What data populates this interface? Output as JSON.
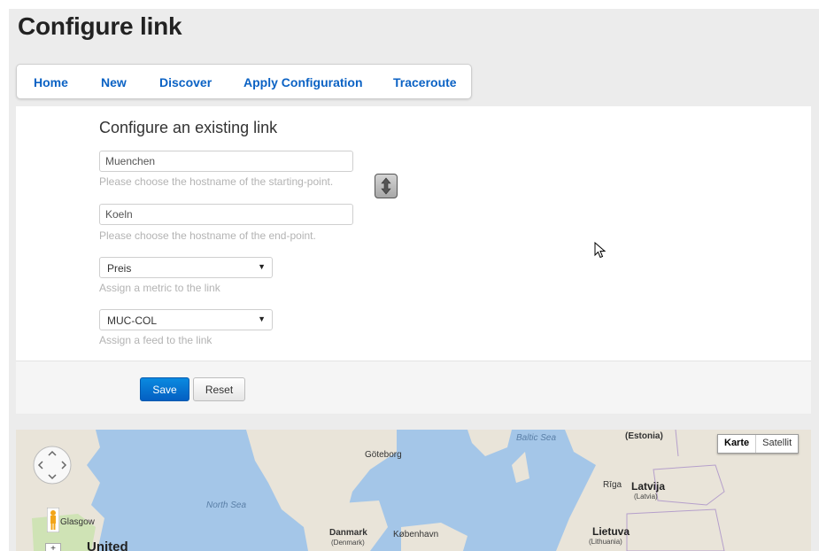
{
  "page": {
    "title": "Configure link"
  },
  "nav": {
    "items": [
      {
        "label": "Home"
      },
      {
        "label": "New"
      },
      {
        "label": "Discover"
      },
      {
        "label": "Apply Configuration"
      },
      {
        "label": "Traceroute"
      }
    ]
  },
  "form": {
    "heading": "Configure an existing link",
    "start": {
      "value": "Muenchen",
      "help": "Please choose the hostname of the starting-point."
    },
    "end": {
      "value": "Koeln",
      "help": "Please choose the hostname of the end-point."
    },
    "metric": {
      "selected": "Preis",
      "help": "Assign a metric to the link"
    },
    "feed": {
      "selected": "MUC-COL",
      "help": "Assign a feed to the link"
    },
    "swap_icon": "swap-arrows-icon"
  },
  "actions": {
    "save_label": "Save",
    "reset_label": "Reset"
  },
  "map": {
    "type_options": {
      "map": "Karte",
      "satellite": "Satellit"
    },
    "labels": {
      "baltic_sea": "Baltic Sea",
      "estonia": "(Estonia)",
      "goteborg": "Göteborg",
      "riga": "Rīga",
      "latvija": "Latvija",
      "latvia": "(Latvia)",
      "north_sea": "North Sea",
      "glasgow": "Glasgow",
      "danmark": "Danmark",
      "denmark": "(Denmark)",
      "kobenhavn": "København",
      "lietuva": "Lietuva",
      "lithuania": "(Lithuania)",
      "united": "United"
    },
    "colors": {
      "water": "#a4c6e8",
      "land": "#e9e4d9",
      "park": "#cfe3b5"
    }
  }
}
